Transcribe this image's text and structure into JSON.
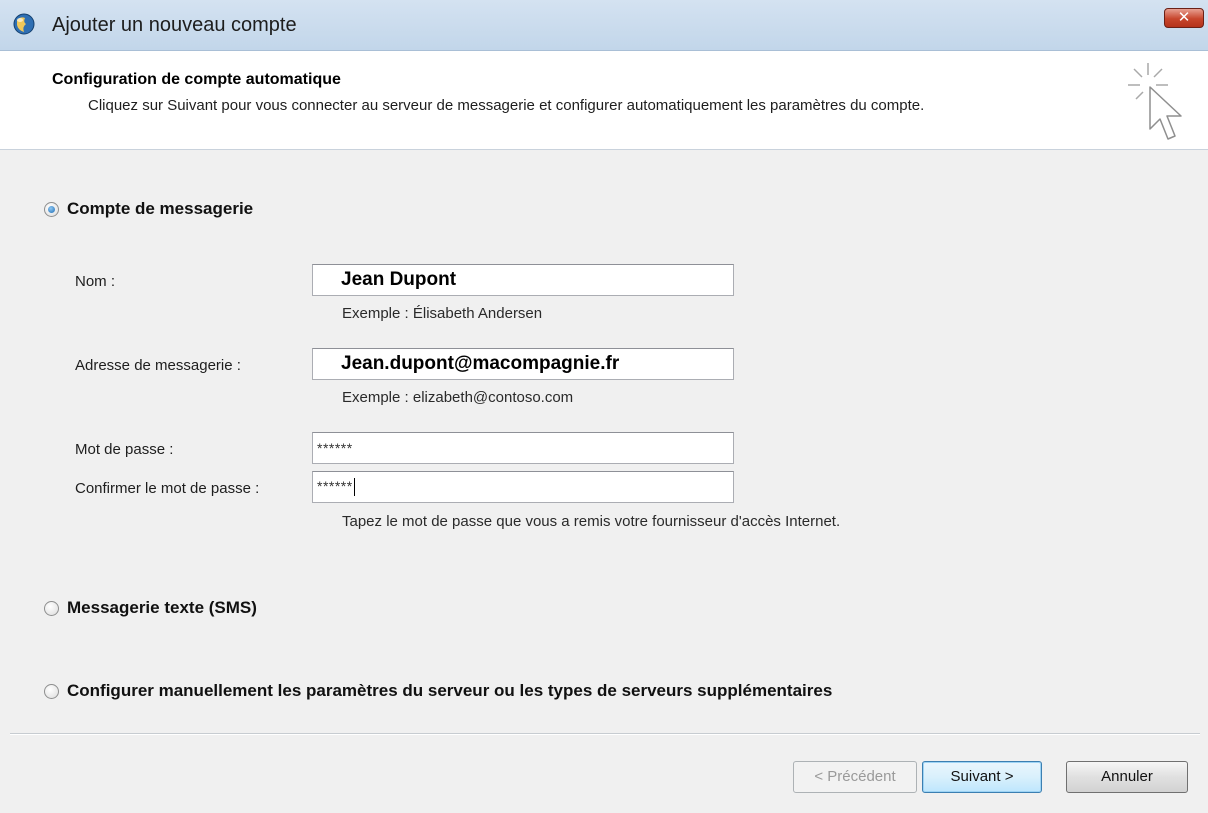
{
  "window": {
    "title": "Ajouter un nouveau compte",
    "close_label": "✕"
  },
  "header": {
    "title": "Configuration de compte automatique",
    "description": "Cliquez sur Suivant pour vous connecter au serveur de messagerie et configurer automatiquement les paramètres du compte."
  },
  "options": [
    {
      "label": "Compte de messagerie",
      "selected": true
    },
    {
      "label": "Messagerie texte (SMS)",
      "selected": false
    },
    {
      "label": "Configurer manuellement les paramètres du serveur ou les types de serveurs supplémentaires",
      "selected": false
    }
  ],
  "form": {
    "name": {
      "label": "Nom :",
      "value": "Jean Dupont",
      "hint": "Exemple : Élisabeth Andersen"
    },
    "email": {
      "label": "Adresse de messagerie :",
      "value": "Jean.dupont@macompagnie.fr",
      "hint": "Exemple : elizabeth@contoso.com"
    },
    "password": {
      "label": "Mot de passe :",
      "value": "******"
    },
    "confirm_password": {
      "label": "Confirmer le mot de passe :",
      "value": "******"
    },
    "password_hint": "Tapez le mot de passe que vous a remis votre fournisseur d'accès Internet."
  },
  "buttons": {
    "previous": "< Précédent",
    "next": "Suivant >",
    "cancel": "Annuler"
  },
  "icons": {
    "app": "outlook-icon",
    "header": "cursor-click-icon",
    "close": "close-icon"
  },
  "colors": {
    "close_button": "#c7452c",
    "default_button_border": "#3c7fb1",
    "radio_selected": "#1f6db5"
  }
}
